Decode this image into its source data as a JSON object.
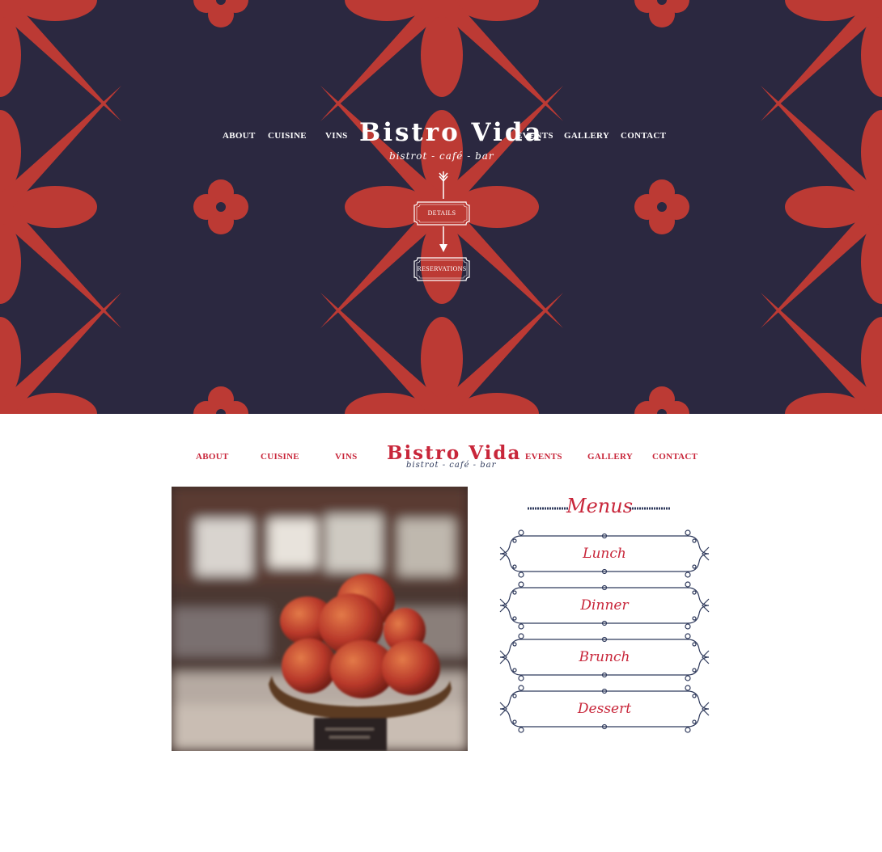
{
  "colors": {
    "navy": "#2b2840",
    "red": "#bc3a34",
    "brand_red": "#c8263a",
    "slate": "#2f3a5c"
  },
  "logo": {
    "title": "Bistro Vida",
    "subtitle": "bistrot - café - bar"
  },
  "nav": {
    "about": "ABOUT",
    "cuisine": "CUISINE",
    "vins": "VINS",
    "events": "EVENTS",
    "gallery": "GALLERY",
    "contact": "CONTACT"
  },
  "hero_buttons": {
    "details": "DETAILS",
    "reservations": "RESERVATIONS"
  },
  "menus": {
    "heading": "Menus",
    "items": [
      "Lunch",
      "Dinner",
      "Brunch",
      "Dessert"
    ]
  },
  "icons": {
    "arrow_down": "arrow-down-icon"
  }
}
